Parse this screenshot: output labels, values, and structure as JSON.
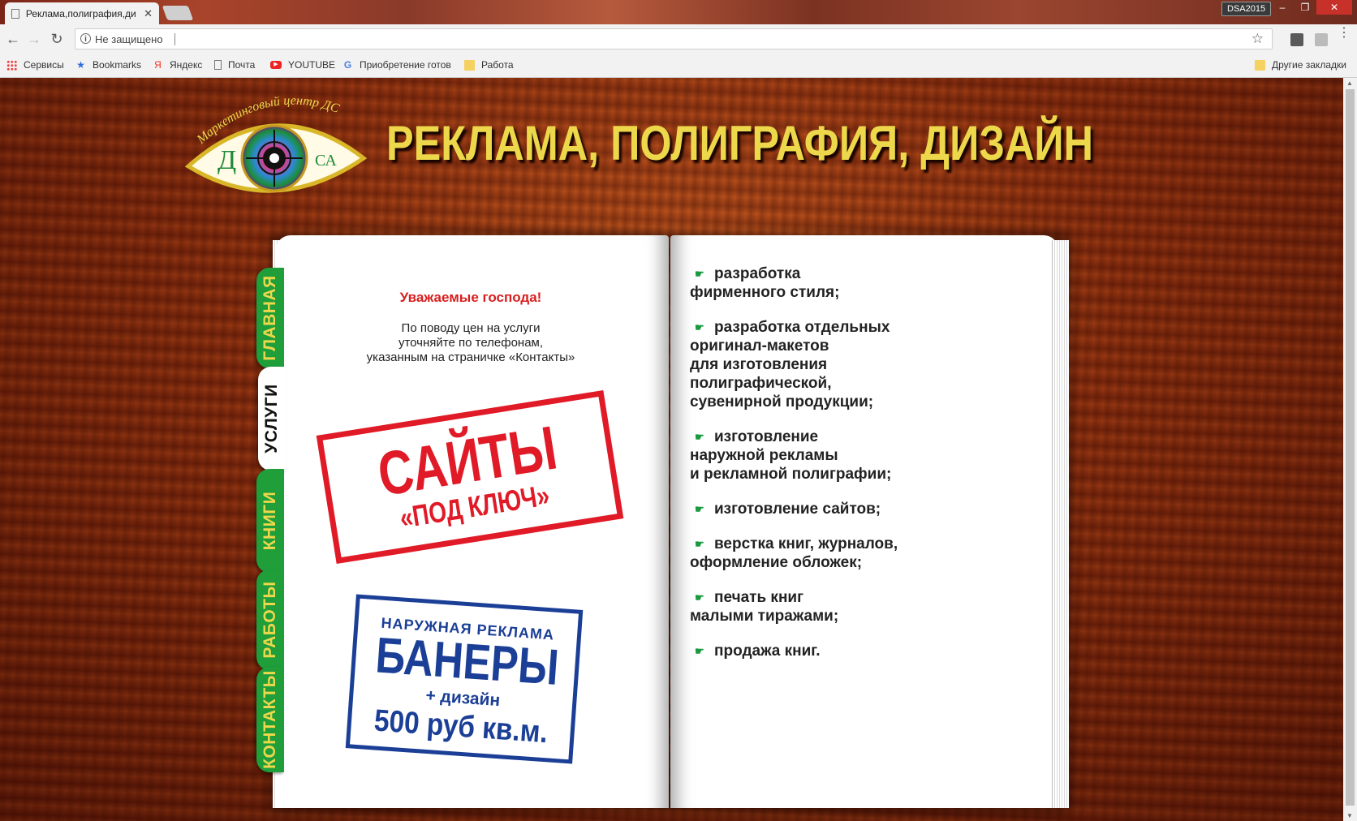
{
  "browser": {
    "tab_title": "Реклама,полиграфия,ди",
    "tab_close": "✕",
    "profile": "DSA2015",
    "security_label": "Не защищено",
    "bookmarks": [
      {
        "label": "Сервисы",
        "icon": "apps-icon"
      },
      {
        "label": "Bookmarks",
        "icon": "star-icon"
      },
      {
        "label": "Яндекс",
        "icon": "yandex-icon"
      },
      {
        "label": "Почта",
        "icon": "page-icon"
      },
      {
        "label": "YOUTUBE",
        "icon": "youtube-icon"
      },
      {
        "label": "Приобретение готов",
        "icon": "google-icon"
      },
      {
        "label": "Работа",
        "icon": "folder-icon"
      }
    ],
    "other_bookmarks": "Другие закладки",
    "icons": {
      "back": "←",
      "forward": "→",
      "reload": "↻",
      "star": "☆",
      "info": "i",
      "yandex": "Я",
      "google": "G"
    },
    "colors": {
      "tabstrip": "#8a3a2a",
      "close": "#c8312a"
    }
  },
  "page": {
    "logo": {
      "arc_text": "Маркетинговый центр ДСА",
      "letter_left": "Д",
      "letter_right": "СА"
    },
    "headline": "РЕКЛАМА, ПОЛИГРАФИЯ, ДИЗАЙН",
    "tabs": [
      {
        "label": "ГЛАВНАЯ",
        "active": false
      },
      {
        "label": "УСЛУГИ",
        "active": true
      },
      {
        "label": "КНИГИ",
        "active": false
      },
      {
        "label": "РАБОТЫ",
        "active": false
      },
      {
        "label": "КОНТАКТЫ",
        "active": false
      }
    ],
    "greeting": "Уважаемые господа!",
    "note": [
      "По поводу цен на услуги",
      "уточняйте по телефонам,",
      "указанным на страничке «Контакты»"
    ],
    "stamp_red": {
      "line1": "САЙТЫ",
      "line2": "«ПОД КЛЮЧ»"
    },
    "stamp_blue": {
      "line1": "НАРУЖНАЯ РЕКЛАМА",
      "line2": "БАНЕРЫ",
      "line3": "+ дизайн",
      "line4": "500 руб кв.м."
    },
    "services": [
      [
        "разработка",
        "фирменного стиля;"
      ],
      [
        "разработка отдельных",
        "оригинал-макетов",
        "для изготовления",
        "полиграфической,",
        "сувенирной продукции;"
      ],
      [
        "изготовление",
        "наружной рекламы",
        "и рекламной полиграфии;"
      ],
      [
        "изготовление сайтов;"
      ],
      [
        "верстка книг, журналов,",
        "оформление обложек;"
      ],
      [
        "печать книг",
        "малыми тиражами;"
      ],
      [
        "продажа книг."
      ]
    ],
    "bullet": "☛",
    "colors": {
      "headline": "#ecd84a",
      "tab_green": "#1f9e3a",
      "stamp_red": "#e01a26",
      "stamp_blue": "#1b3f96",
      "greeting": "#d81e1e"
    }
  }
}
